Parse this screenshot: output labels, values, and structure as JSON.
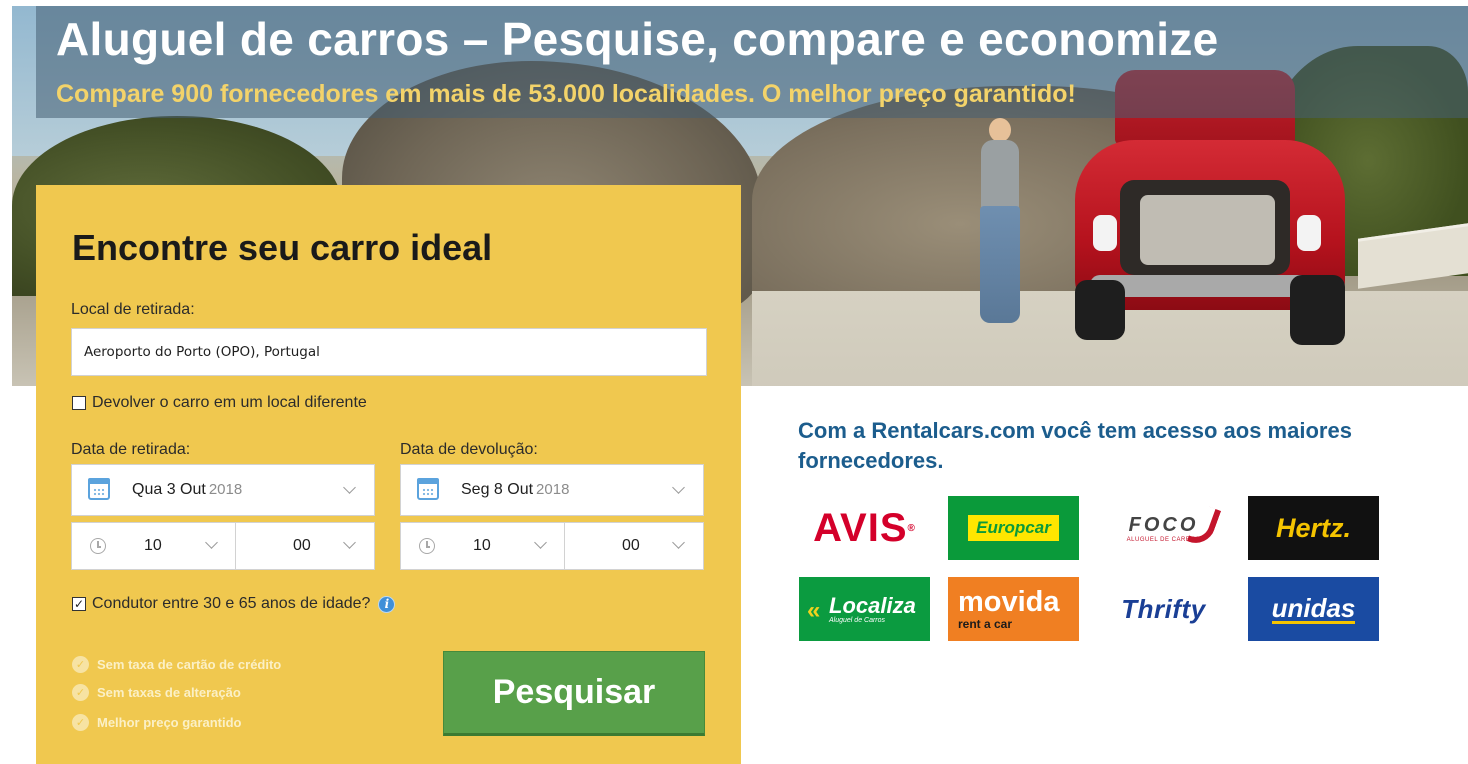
{
  "hero": {
    "title": "Aluguel de carros – Pesquise, compare e economize",
    "subtitle": "Compare 900 fornecedores em mais de 53.000 localidades. O melhor preço garantido!"
  },
  "search_form": {
    "title": "Encontre seu carro ideal",
    "pickup_location_label": "Local de retirada:",
    "pickup_location_value": "Aeroporto do Porto (OPO), Portugal",
    "different_return_label": "Devolver o carro em um local diferente",
    "different_return_checked": false,
    "pickup_date_label": "Data de retirada:",
    "pickup_date": {
      "day": "Qua 3 Out",
      "year": "2018"
    },
    "return_date_label": "Data de devolução:",
    "return_date": {
      "day": "Seg 8 Out",
      "year": "2018"
    },
    "pickup_time": {
      "hour": "10",
      "minute": "00"
    },
    "return_time": {
      "hour": "10",
      "minute": "00"
    },
    "driver_age_label": "Condutor entre 30 e 65 anos de idade?",
    "driver_age_checked": true,
    "checked_mark": "✓",
    "benefits": [
      "Sem taxa de cartão de crédito",
      "Sem taxas de alteração",
      "Melhor preço garantido"
    ],
    "search_button": "Pesquisar"
  },
  "suppliers": {
    "title": "Com a Rentalcars.com você tem acesso aos maiores fornecedores.",
    "logos": {
      "avis": "AVIS",
      "europcar": "Europcar",
      "foco": "FOCO",
      "foco_tagline": "ALUGUEL DE CARROS",
      "hertz": "Hertz.",
      "localiza": "Localiza",
      "localiza_tagline": "Aluguel de Carros",
      "movida": "movida",
      "movida_tagline": "rent a car",
      "thrifty": "Thrifty",
      "unidas": "unidas"
    }
  },
  "colors": {
    "form_background": "#f0c84f",
    "search_button": "#58a04a",
    "suppliers_title": "#1c5d8d",
    "hero_subtitle": "#f3d36a"
  },
  "icons": [
    "calendar-icon",
    "clock-icon",
    "chevron-down-icon",
    "info-icon",
    "check-icon"
  ]
}
